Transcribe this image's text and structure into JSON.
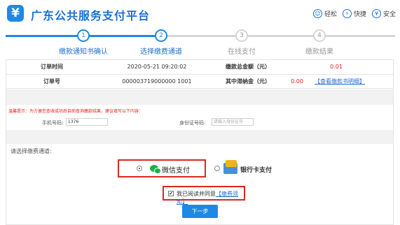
{
  "header": {
    "logo_glyph": "¥",
    "title": "广东公共服务支付平台",
    "actions": [
      {
        "label": "轻松",
        "icon": "smile-icon",
        "glyph": "☺"
      },
      {
        "label": "快捷",
        "icon": "lightning-icon",
        "glyph": "⚡"
      },
      {
        "label": "安全",
        "icon": "shield-yen-icon",
        "glyph": "¥"
      }
    ]
  },
  "steps": [
    {
      "num": "1",
      "label": "缴款通知书确认",
      "active": true
    },
    {
      "num": "2",
      "label": "选择缴费通道",
      "active": true
    },
    {
      "num": "3",
      "label": "在线支付",
      "active": false
    },
    {
      "num": "4",
      "label": "缴款结果",
      "active": false
    }
  ],
  "order": {
    "time_label": "订单时间",
    "time_value": "2020-05-21 09:20:02",
    "total_label": "缴款总金额（元）",
    "total_value": "0.01",
    "order_no_label": "订单号",
    "order_no_value": "000003719000000 1001",
    "late_fee_label": "其中滞纳金（元）",
    "late_fee_value": "0.00",
    "detail_link": "【查看缴款书明细】"
  },
  "warning": "温馨提示：为方便您查收成功后自助查询缴款结果，建议填写以下内容：",
  "fields": {
    "phone_label": "手机号码:",
    "phone_value": "1376",
    "id_label": "身份证号码:",
    "id_placeholder": "请输入身份证号"
  },
  "channel": {
    "prompt": "请选择缴费通道:",
    "wechat_label": "微信支付",
    "bank_label": "银行卡支付",
    "selected": "wechat"
  },
  "agreement": {
    "checked_glyph": "✔",
    "text": "我已阅读并同意",
    "link": "【缴费须知】"
  },
  "next_button": "下一步",
  "colors": {
    "brand": "#1e6fd1",
    "highlight": "#d9291c",
    "wechat": "#19b24a"
  }
}
